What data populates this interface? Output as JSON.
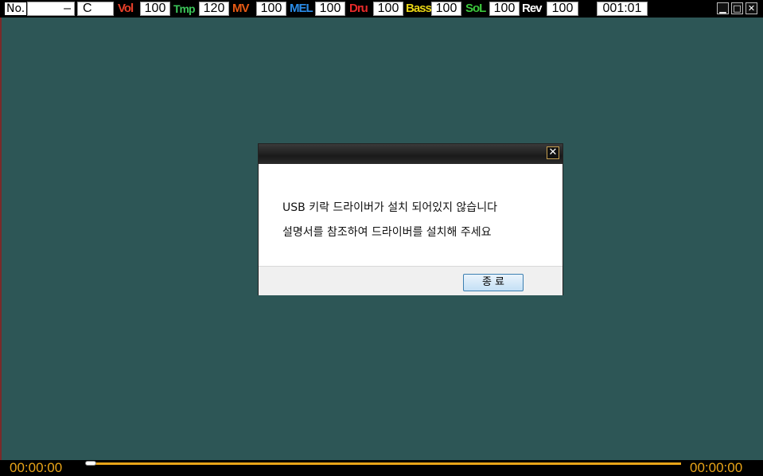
{
  "topbar": {
    "no_label": "No.",
    "song_number": "–",
    "key": "C",
    "vol_label": "Vol",
    "vol_value": "100",
    "tmp_label": "Tmp",
    "tmp_value": "120",
    "mv_label": "MV",
    "mv_value": "100",
    "mel_label": "MEL",
    "mel_value": "100",
    "dru_label": "Dru",
    "dru_value": "100",
    "bass_label": "Bass",
    "bass_value": "100",
    "sol_label": "SoL",
    "sol_value": "100",
    "rev_label": "Rev",
    "rev_value": "100",
    "position": "001:01",
    "win_buttons": {
      "minimize": "▁",
      "maximize": "□",
      "close": "✕"
    }
  },
  "colors": {
    "vol": "#e8402a",
    "tmp": "#3cc85a",
    "mv": "#e85a14",
    "mel": "#2a8ce8",
    "dru": "#e82a2a",
    "bass": "#e8d414",
    "sol": "#3cc83c",
    "rev": "#ffffff",
    "time": "#e8a418",
    "background": "#2d5656"
  },
  "dialog": {
    "close_icon": "✕",
    "line1": "USB 키락 드라이버가 설치 되어있지 않습니다",
    "line2": "설명서를 참조하여 드라이버를 설치해 주세요",
    "button_label": "종  료"
  },
  "player": {
    "elapsed": "00:00:00",
    "total": "00:00:00",
    "progress": 0
  }
}
